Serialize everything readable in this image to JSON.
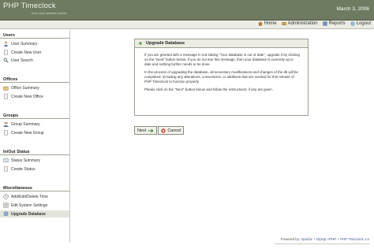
{
  "header": {
    "title": "PHP Timeclock",
    "subtitle": "time clock          website tracker",
    "date": "March 3, 2006"
  },
  "topnav": {
    "items": [
      {
        "label": "Home",
        "icon": "home-icon"
      },
      {
        "label": "Administration",
        "icon": "admin-icon"
      },
      {
        "label": "Reports",
        "icon": "reports-icon"
      },
      {
        "label": "Logout",
        "icon": "logout-icon"
      }
    ]
  },
  "sidebar": {
    "users": {
      "title": "Users",
      "items": [
        "User Summary",
        "Create New User",
        "User Search"
      ]
    },
    "offices": {
      "title": "Offices",
      "items": [
        "Office Summary",
        "Create New Office"
      ]
    },
    "groups": {
      "title": "Groups",
      "items": [
        "Group Summary",
        "Create New Group"
      ]
    },
    "status": {
      "title": "In/Out Status",
      "items": [
        "Status Summary",
        "Create Status"
      ]
    },
    "misc": {
      "title": "Miscellaneous",
      "items": [
        "Add/Edit/Delete Time",
        "Edit System Settings",
        "Upgrade Database"
      ]
    }
  },
  "panel": {
    "title": "Upgrade Database",
    "p1": "If you are greeted with a message in red stating \"Your database is out of date\", upgrade it by clicking on the \"Next\" button below. If you do not see this message, then your database is currently up to date and nothing further needs to be done.",
    "p2": "In the process of upgrading the database, all necessary modifications and changes of the db will be completed, including any alterations, conversions, or additions that are needed for this release of PHP Timeclock to function properly.",
    "p3": "Please click on the \"Next\" button below and follow the instructions, if any are given."
  },
  "buttons": {
    "next": "Next",
    "cancel": "Cancel"
  },
  "footer": {
    "powered_by": "Powered by:",
    "apache": "Apache",
    "sep1": " + ",
    "mysql": "MySql",
    "sep2": " +",
    "php": "PHP",
    "sep3": " + ",
    "app": "PHP Timeclock 1.0"
  },
  "colors": {
    "header_bg": "#6e7b61",
    "nav_bg": "#ececE4",
    "link": "#3b5c8d"
  }
}
